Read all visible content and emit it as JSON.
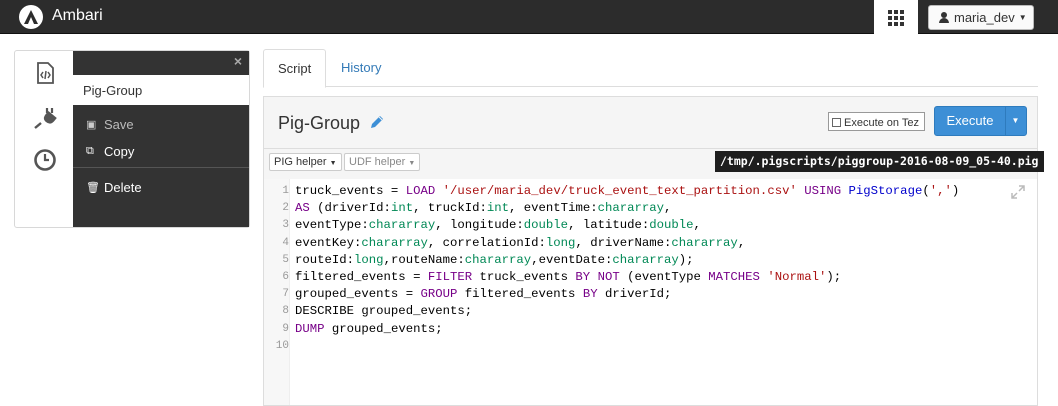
{
  "app": {
    "brand": "Ambari",
    "user": "maria_dev"
  },
  "sidebar": {
    "icons": [
      "code-file-icon",
      "plug-icon",
      "clock-icon"
    ],
    "script_name": "Pig-Group",
    "menu": [
      {
        "label": "Save",
        "icon": "save-icon",
        "disabled": true
      },
      {
        "label": "Copy",
        "icon": "copy-icon",
        "disabled": false
      },
      {
        "label": "Delete",
        "icon": "trash-icon",
        "disabled": false
      }
    ]
  },
  "tabs": [
    {
      "label": "Script",
      "active": true
    },
    {
      "label": "History",
      "active": false
    }
  ],
  "editor": {
    "title": "Pig-Group",
    "tez_label": "Execute on Tez",
    "execute_label": "Execute",
    "pig_helper": "PIG helper",
    "udf_helper": "UDF helper",
    "script_path": "/tmp/.pigscripts/piggroup-2016-08-09_05-40.pig",
    "line_numbers": [
      "1",
      "2",
      "3",
      "4",
      "5",
      "6",
      "7",
      "8",
      "9",
      "10"
    ],
    "code_lines": [
      [
        [
          "",
          "truck_events = "
        ],
        [
          "kw",
          "LOAD"
        ],
        [
          "",
          " "
        ],
        [
          "st",
          "'/user/maria_dev/truck_event_text_partition.csv'"
        ],
        [
          "",
          " "
        ],
        [
          "kw",
          "USING"
        ],
        [
          "",
          " "
        ],
        [
          "fn",
          "PigStorage"
        ],
        [
          "",
          "("
        ],
        [
          "st",
          "','"
        ],
        [
          "",
          ")"
        ]
      ],
      [
        [
          "kw",
          "AS"
        ],
        [
          "",
          " (driverId:"
        ],
        [
          "ty",
          "int"
        ],
        [
          "",
          ", truckId:"
        ],
        [
          "ty",
          "int"
        ],
        [
          "",
          ", eventTime:"
        ],
        [
          "ty",
          "chararray"
        ],
        [
          "",
          ","
        ]
      ],
      [
        [
          "",
          "eventType:"
        ],
        [
          "ty",
          "chararray"
        ],
        [
          "",
          ", longitude:"
        ],
        [
          "ty",
          "double"
        ],
        [
          "",
          ", latitude:"
        ],
        [
          "ty",
          "double"
        ],
        [
          "",
          ","
        ]
      ],
      [
        [
          "",
          "eventKey:"
        ],
        [
          "ty",
          "chararray"
        ],
        [
          "",
          ", correlationId:"
        ],
        [
          "ty",
          "long"
        ],
        [
          "",
          ", driverName:"
        ],
        [
          "ty",
          "chararray"
        ],
        [
          "",
          ","
        ]
      ],
      [
        [
          "",
          "routeId:"
        ],
        [
          "ty",
          "long"
        ],
        [
          "",
          ",routeName:"
        ],
        [
          "ty",
          "chararray"
        ],
        [
          "",
          ",eventDate:"
        ],
        [
          "ty",
          "chararray"
        ],
        [
          "",
          ");"
        ]
      ],
      [
        [
          "",
          "filtered_events = "
        ],
        [
          "kw",
          "FILTER"
        ],
        [
          "",
          " truck_events "
        ],
        [
          "kw",
          "BY"
        ],
        [
          "",
          " "
        ],
        [
          "kw",
          "NOT"
        ],
        [
          "",
          " (eventType "
        ],
        [
          "kw",
          "MATCHES"
        ],
        [
          "",
          " "
        ],
        [
          "st",
          "'Normal'"
        ],
        [
          "",
          ");"
        ]
      ],
      [
        [
          "",
          "grouped_events = "
        ],
        [
          "kw",
          "GROUP"
        ],
        [
          "",
          " filtered_events "
        ],
        [
          "kw",
          "BY"
        ],
        [
          "",
          " driverId;"
        ]
      ],
      [
        [
          "",
          "DESCRIBE grouped_events;"
        ]
      ],
      [
        [
          "kw",
          "DUMP"
        ],
        [
          "",
          " grouped_events;"
        ]
      ],
      [
        [
          "",
          ""
        ]
      ]
    ]
  }
}
